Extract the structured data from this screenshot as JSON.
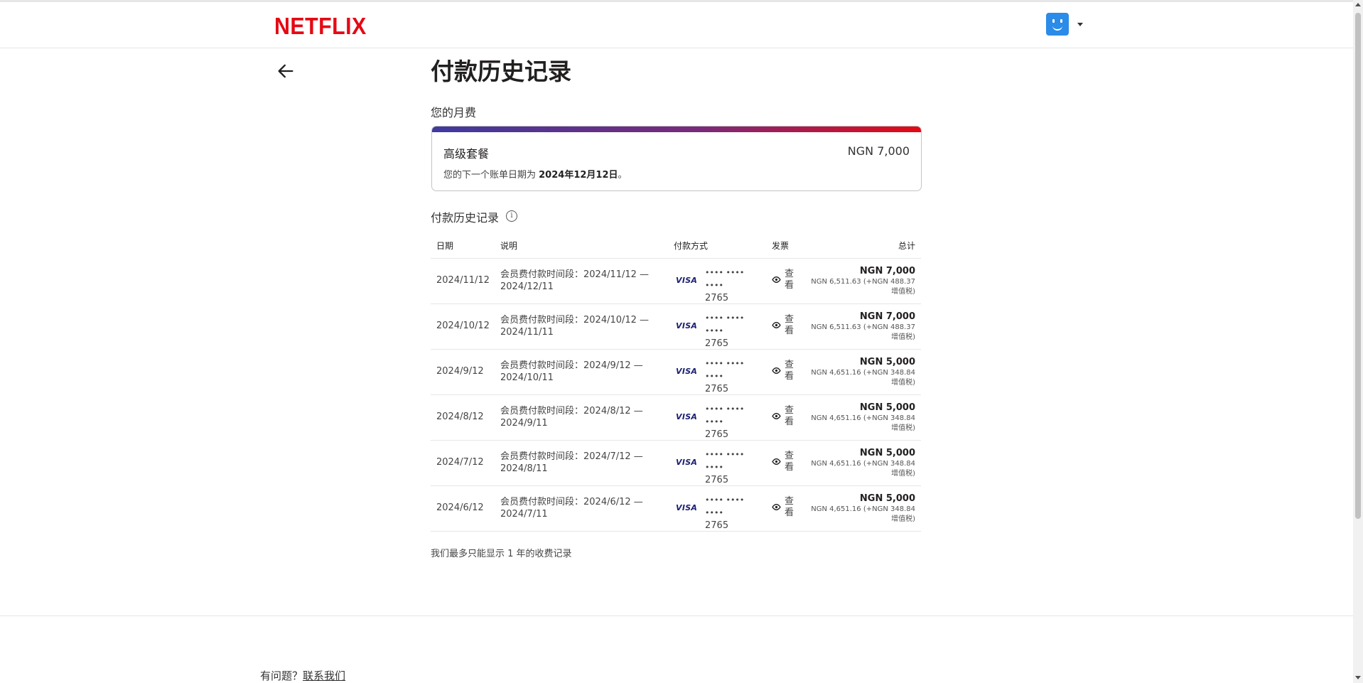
{
  "header": {
    "logo": "NETFLIX"
  },
  "page": {
    "title": "付款历史记录",
    "monthly_label": "您的月费"
  },
  "plan": {
    "name": "高级套餐",
    "price": "NGN 7,000",
    "next_prefix": "您的下一个账单日期为 ",
    "next_date": "2024年12月12日",
    "next_suffix": "。"
  },
  "history": {
    "label": "付款历史记录",
    "info_icon": "i",
    "headers": {
      "date": "日期",
      "desc": "说明",
      "method": "付款方式",
      "invoice": "发票",
      "total": "总计"
    },
    "rows": [
      {
        "date": "2024/11/12",
        "desc": "会员费付款时间段：2024/11/12 — 2024/12/11",
        "brand": "VISA",
        "masked": "•••• •••• ••••",
        "last4": "2765",
        "view": "查看",
        "total": "NGN 7,000",
        "tax": "NGN 6,511.63 (+NGN 488.37 增值税)"
      },
      {
        "date": "2024/10/12",
        "desc": "会员费付款时间段：2024/10/12 — 2024/11/11",
        "brand": "VISA",
        "masked": "•••• •••• ••••",
        "last4": "2765",
        "view": "查看",
        "total": "NGN 7,000",
        "tax": "NGN 6,511.63 (+NGN 488.37 增值税)"
      },
      {
        "date": "2024/9/12",
        "desc": "会员费付款时间段：2024/9/12 — 2024/10/11",
        "brand": "VISA",
        "masked": "•••• •••• ••••",
        "last4": "2765",
        "view": "查看",
        "total": "NGN 5,000",
        "tax": "NGN 4,651.16 (+NGN 348.84 增值税)"
      },
      {
        "date": "2024/8/12",
        "desc": "会员费付款时间段：2024/8/12 — 2024/9/11",
        "brand": "VISA",
        "masked": "•••• •••• ••••",
        "last4": "2765",
        "view": "查看",
        "total": "NGN 5,000",
        "tax": "NGN 4,651.16 (+NGN 348.84 增值税)"
      },
      {
        "date": "2024/7/12",
        "desc": "会员费付款时间段：2024/7/12 — 2024/8/11",
        "brand": "VISA",
        "masked": "•••• •••• ••••",
        "last4": "2765",
        "view": "查看",
        "total": "NGN 5,000",
        "tax": "NGN 4,651.16 (+NGN 348.84 增值税)"
      },
      {
        "date": "2024/6/12",
        "desc": "会员费付款时间段：2024/6/12 — 2024/7/11",
        "brand": "VISA",
        "masked": "•••• •••• ••••",
        "last4": "2765",
        "view": "查看",
        "total": "NGN 5,000",
        "tax": "NGN 4,651.16 (+NGN 348.84 增值税)"
      }
    ],
    "note": "我们最多只能显示 1 年的收费记录"
  },
  "footer": {
    "question": "有问题？",
    "contact": "联系我们"
  },
  "colors": {
    "brand_red": "#e50914",
    "avatar_blue": "#2b8be8",
    "gradient_start": "#3f3a9e"
  },
  "icons": [
    "back-arrow-icon",
    "info-icon",
    "view-eye-icon",
    "caret-down-icon",
    "profile-avatar"
  ]
}
